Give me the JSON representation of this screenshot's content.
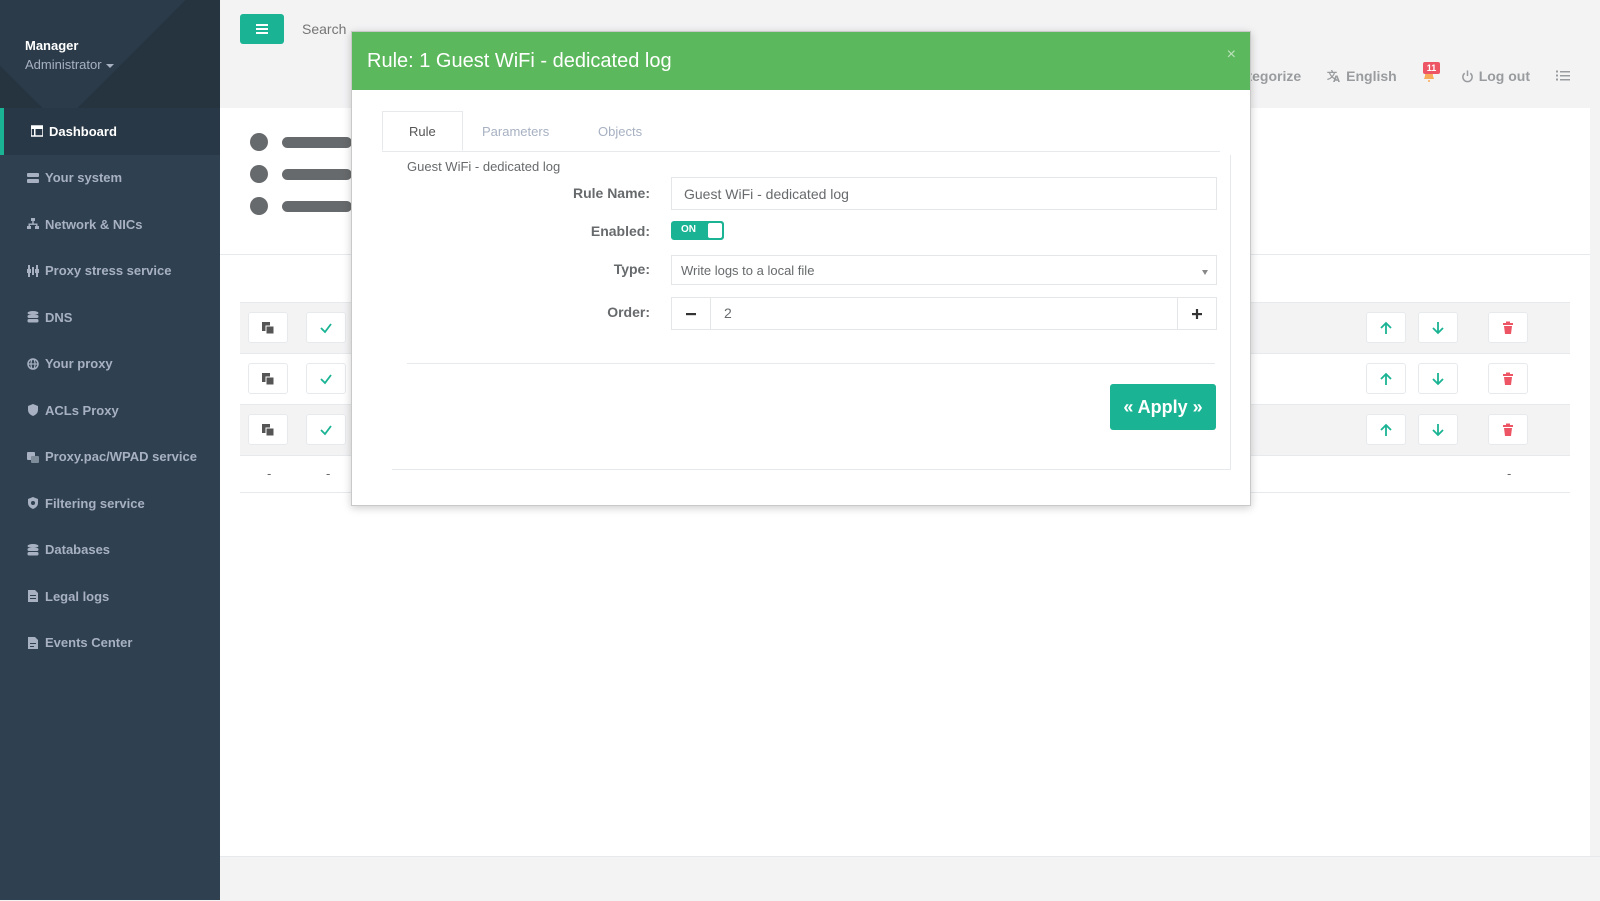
{
  "sidebar": {
    "profile": {
      "name": "Manager",
      "role": "Administrator"
    },
    "items": [
      {
        "label": "Dashboard",
        "icon": "dashboard-icon"
      },
      {
        "label": "Your system",
        "icon": "server-icon"
      },
      {
        "label": "Network & NICs",
        "icon": "network-icon"
      },
      {
        "label": "Proxy stress service",
        "icon": "stress-icon"
      },
      {
        "label": "DNS",
        "icon": "database-icon"
      },
      {
        "label": "Your proxy",
        "icon": "globe-icon"
      },
      {
        "label": "ACLs Proxy",
        "icon": "shield-icon"
      },
      {
        "label": "Proxy.pac/WPAD service",
        "icon": "script-icon"
      },
      {
        "label": "Filtering service",
        "icon": "filter-shield-icon"
      },
      {
        "label": "Databases",
        "icon": "database-icon"
      },
      {
        "label": "Legal logs",
        "icon": "document-icon"
      },
      {
        "label": "Events Center",
        "icon": "file-icon"
      }
    ]
  },
  "topbar": {
    "search_placeholder": "Search",
    "nav": {
      "categorize": "ategorize",
      "language": "English",
      "notifications_count": "11",
      "logout": "Log out"
    }
  },
  "table": {
    "footer_dash": "-"
  },
  "modal": {
    "title": "Rule: 1 Guest WiFi - dedicated log",
    "close": "×",
    "tabs": [
      "Rule",
      "Parameters",
      "Objects"
    ],
    "panel_title": "Guest WiFi - dedicated log",
    "form": {
      "rule_name_label": "Rule Name:",
      "rule_name_value": "Guest WiFi - dedicated log",
      "enabled_label": "Enabled:",
      "enabled_state": "ON",
      "type_label": "Type:",
      "type_value": "Write logs to a local file",
      "order_label": "Order:",
      "order_value": "2"
    },
    "apply_label": "« Apply »"
  },
  "colors": {
    "sidebar_bg": "#2f4050",
    "accent": "#1ab394",
    "modal_header": "#5cb85c",
    "danger": "#ed5565"
  }
}
